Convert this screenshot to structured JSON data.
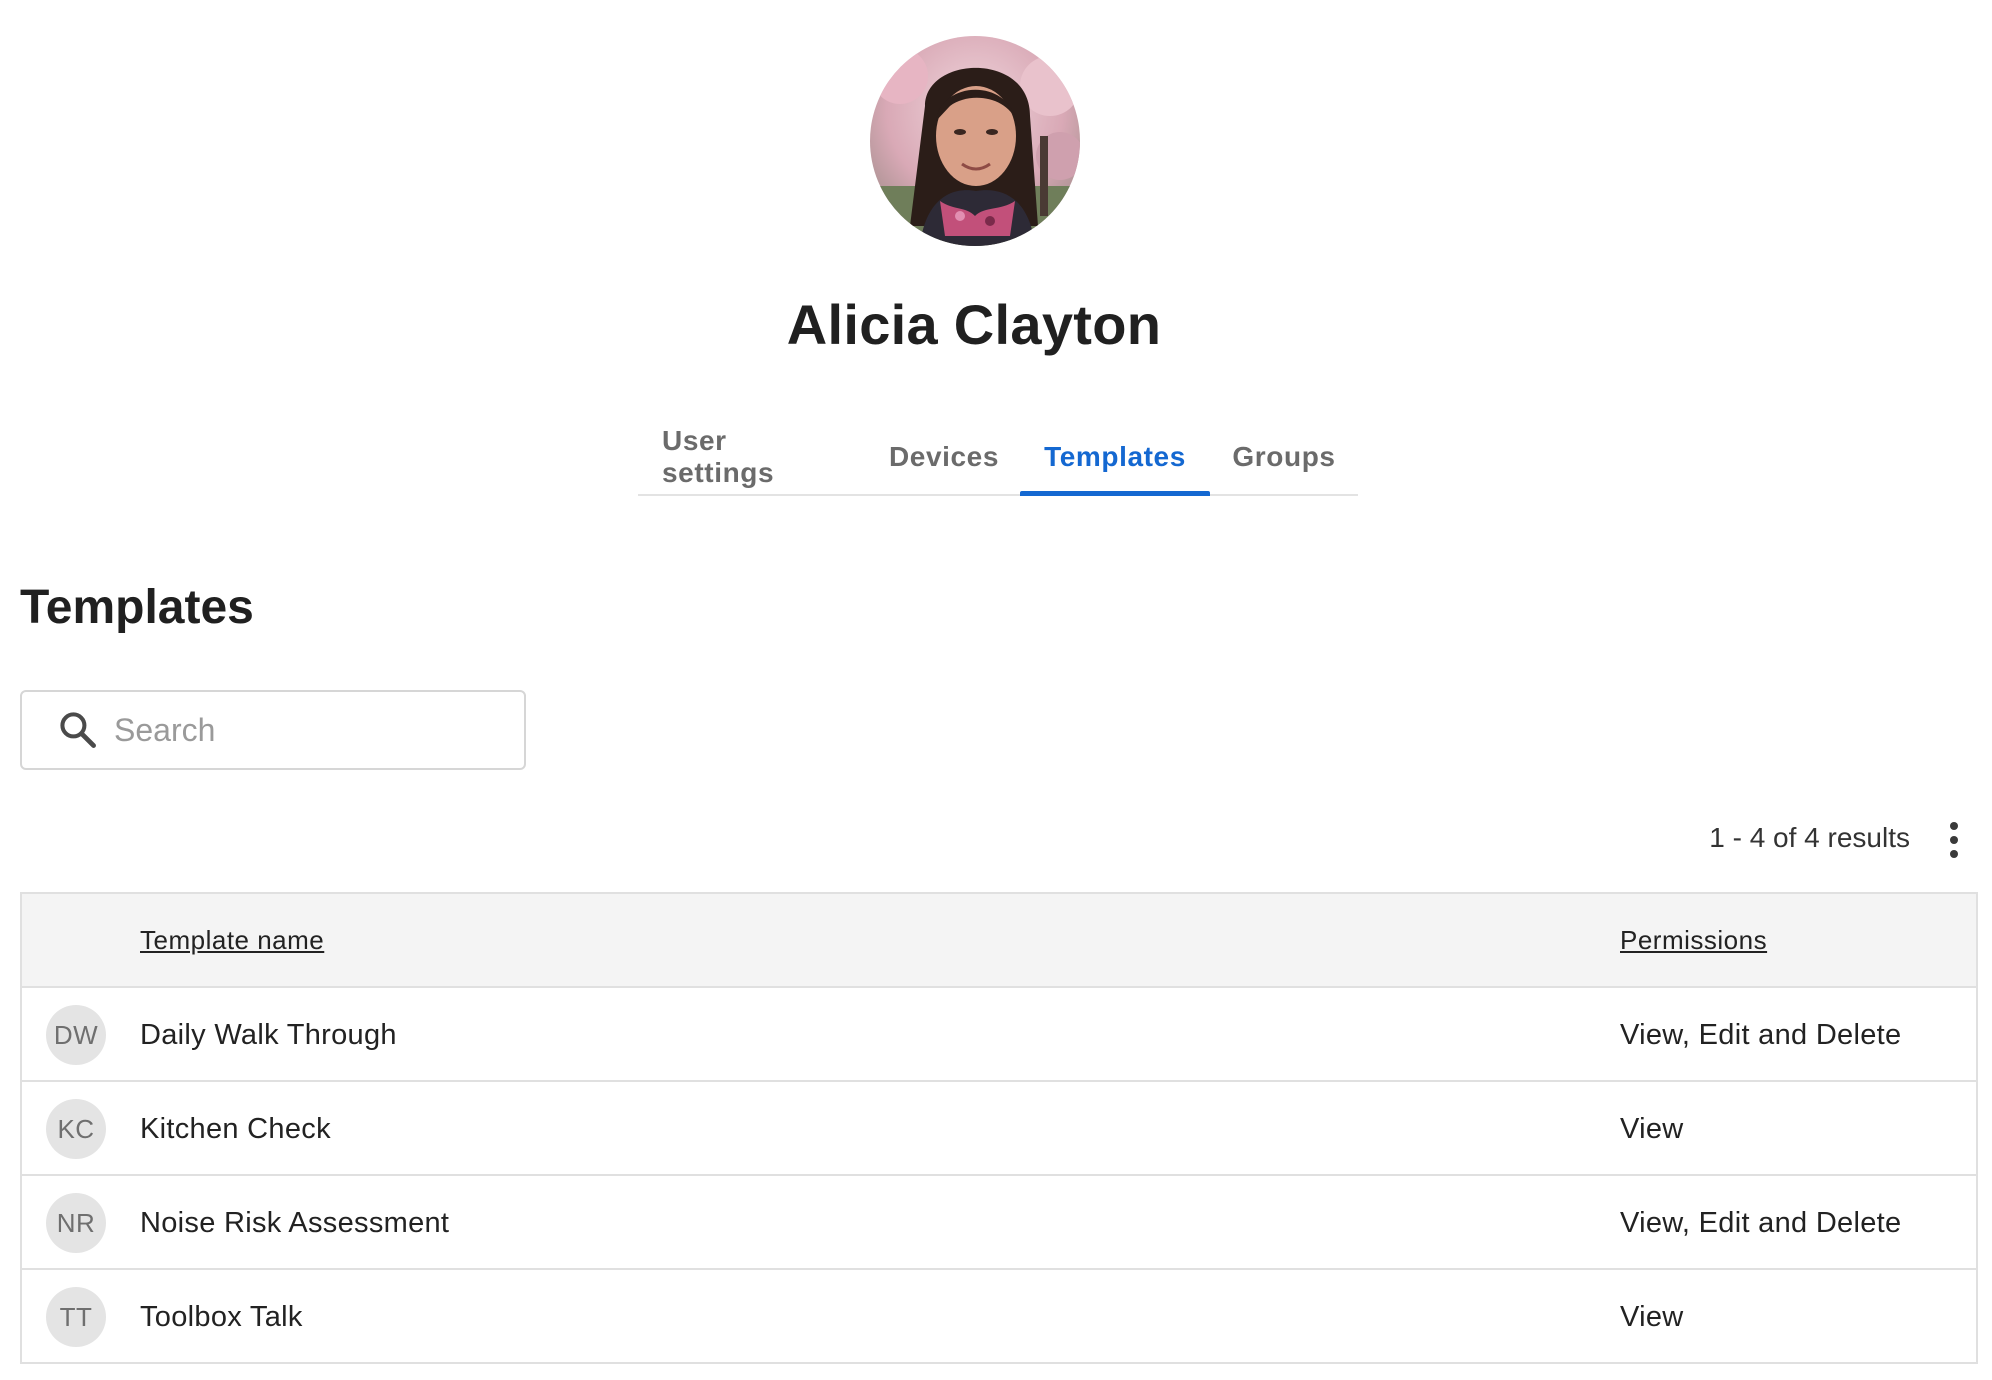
{
  "profile": {
    "name": "Alicia Clayton"
  },
  "tabs": [
    {
      "label": "User settings",
      "active": false
    },
    {
      "label": "Devices",
      "active": false
    },
    {
      "label": "Templates",
      "active": true
    },
    {
      "label": "Groups",
      "active": false
    }
  ],
  "section": {
    "title": "Templates"
  },
  "search": {
    "placeholder": "Search",
    "value": ""
  },
  "results": {
    "summary": "1 - 4 of 4 results"
  },
  "table": {
    "columns": [
      "Template name",
      "Permissions"
    ],
    "rows": [
      {
        "initials": "DW",
        "name": "Daily Walk Through",
        "permissions": "View, Edit and Delete"
      },
      {
        "initials": "KC",
        "name": "Kitchen Check",
        "permissions": "View"
      },
      {
        "initials": "NR",
        "name": "Noise Risk Assessment",
        "permissions": "View, Edit and Delete"
      },
      {
        "initials": "TT",
        "name": "Toolbox Talk",
        "permissions": "View"
      }
    ]
  },
  "colors": {
    "accent": "#1468d1",
    "tab_inactive": "#6b6b6b",
    "header_bg": "#f4f4f4",
    "avatar_bg": "#e4e4e4"
  },
  "icons": {
    "search": "search-icon",
    "more": "more-vertical-icon"
  }
}
